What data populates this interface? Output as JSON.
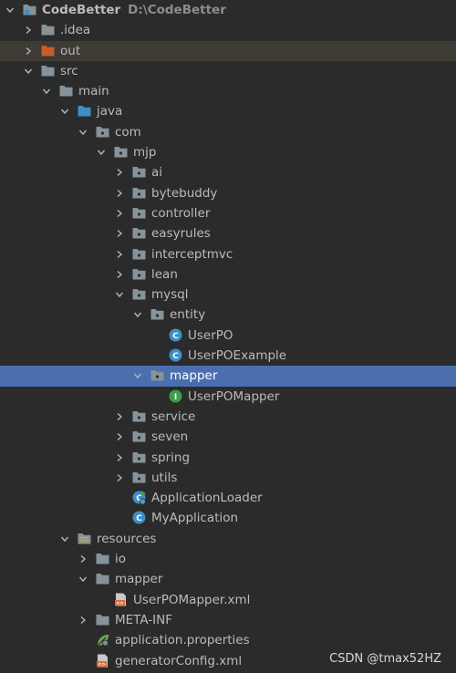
{
  "project": {
    "name": "CodeBetter",
    "path": "D:\\CodeBetter"
  },
  "tree": [
    {
      "label": "CodeBetter",
      "hint": "D:\\CodeBetter",
      "depth": 0,
      "arrow": "down",
      "icon": "project-icon",
      "bold": true
    },
    {
      "label": ".idea",
      "depth": 1,
      "arrow": "right",
      "icon": "folder-icon"
    },
    {
      "label": "out",
      "depth": 1,
      "arrow": "right",
      "icon": "excluded-folder-icon",
      "state": "out"
    },
    {
      "label": "src",
      "depth": 1,
      "arrow": "down",
      "icon": "folder-icon"
    },
    {
      "label": "main",
      "depth": 2,
      "arrow": "down",
      "icon": "folder-icon"
    },
    {
      "label": "java",
      "depth": 3,
      "arrow": "down",
      "icon": "source-folder-icon"
    },
    {
      "label": "com",
      "depth": 4,
      "arrow": "down",
      "icon": "package-icon"
    },
    {
      "label": "mjp",
      "depth": 5,
      "arrow": "down",
      "icon": "package-icon"
    },
    {
      "label": "ai",
      "depth": 6,
      "arrow": "right",
      "icon": "package-icon"
    },
    {
      "label": "bytebuddy",
      "depth": 6,
      "arrow": "right",
      "icon": "package-icon"
    },
    {
      "label": "controller",
      "depth": 6,
      "arrow": "right",
      "icon": "package-icon"
    },
    {
      "label": "easyrules",
      "depth": 6,
      "arrow": "right",
      "icon": "package-icon"
    },
    {
      "label": "interceptmvc",
      "depth": 6,
      "arrow": "right",
      "icon": "package-icon"
    },
    {
      "label": "lean",
      "depth": 6,
      "arrow": "right",
      "icon": "package-icon"
    },
    {
      "label": "mysql",
      "depth": 6,
      "arrow": "down",
      "icon": "package-icon"
    },
    {
      "label": "entity",
      "depth": 7,
      "arrow": "down",
      "icon": "package-icon"
    },
    {
      "label": "UserPO",
      "depth": 8,
      "arrow": "none",
      "icon": "class-icon"
    },
    {
      "label": "UserPOExample",
      "depth": 8,
      "arrow": "none",
      "icon": "class-icon"
    },
    {
      "label": "mapper",
      "depth": 7,
      "arrow": "down",
      "icon": "package-icon",
      "state": "selected"
    },
    {
      "label": "UserPOMapper",
      "depth": 8,
      "arrow": "none",
      "icon": "interface-icon"
    },
    {
      "label": "service",
      "depth": 6,
      "arrow": "right",
      "icon": "package-icon"
    },
    {
      "label": "seven",
      "depth": 6,
      "arrow": "right",
      "icon": "package-icon"
    },
    {
      "label": "spring",
      "depth": 6,
      "arrow": "right",
      "icon": "package-icon"
    },
    {
      "label": "utils",
      "depth": 6,
      "arrow": "right",
      "icon": "package-icon"
    },
    {
      "label": "ApplicationLoader",
      "depth": 6,
      "arrow": "none",
      "icon": "runnable-class-icon"
    },
    {
      "label": "MyApplication",
      "depth": 6,
      "arrow": "none",
      "icon": "class-icon"
    },
    {
      "label": "resources",
      "depth": 3,
      "arrow": "down",
      "icon": "resources-folder-icon"
    },
    {
      "label": "io",
      "depth": 4,
      "arrow": "right",
      "icon": "folder-icon"
    },
    {
      "label": "mapper",
      "depth": 4,
      "arrow": "down",
      "icon": "folder-icon"
    },
    {
      "label": "UserPOMapper.xml",
      "depth": 5,
      "arrow": "none",
      "icon": "xml-file-icon"
    },
    {
      "label": "META-INF",
      "depth": 4,
      "arrow": "right",
      "icon": "folder-icon"
    },
    {
      "label": "application.properties",
      "depth": 4,
      "arrow": "none",
      "icon": "spring-properties-icon"
    },
    {
      "label": "generatorConfig.xml",
      "depth": 4,
      "arrow": "none",
      "icon": "xml-file-icon"
    }
  ],
  "watermark": "CSDN @tmax52HZ",
  "colors": {
    "background": "#2b2b2b",
    "selection": "#4b6eaf",
    "excluded_row": "#3e3a34",
    "folder": "#87939a",
    "source_folder": "#3f8fc4",
    "excluded_folder": "#c75d2c",
    "class": "#3d8fc6",
    "interface": "#3f9c48"
  }
}
